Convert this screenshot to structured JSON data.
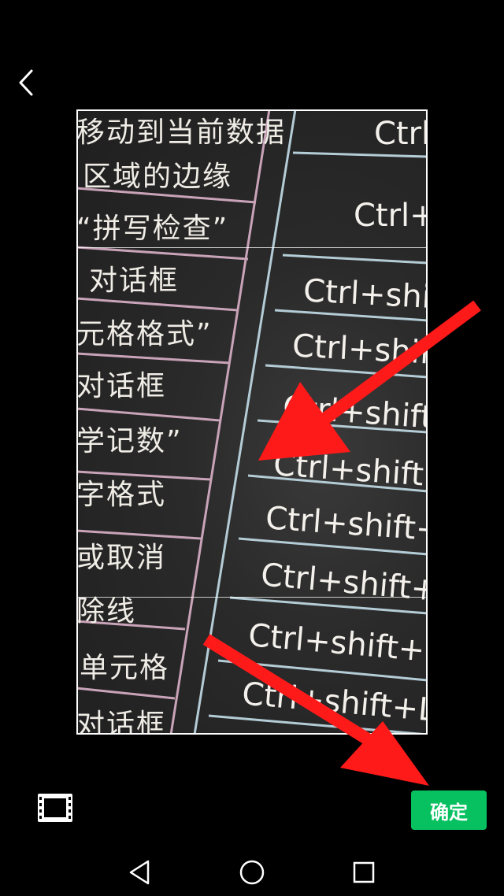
{
  "header": {
    "back_icon": "chevron-left-icon"
  },
  "photo": {
    "left_column_text": [
      "移动到当前数据",
      "区域的边缘",
      "“拼写检查”",
      "对话框",
      "元格格式”",
      "对话框",
      "学记数”",
      "字格式",
      "或取消",
      "除线",
      "单元格",
      "对话框"
    ],
    "right_column_text": [
      "Ctrl",
      "Ctrl+",
      "Ctrl+shif",
      "Ctrl+shif",
      "Ctrl+shift",
      "Ctrl+shift+",
      "Ctrl+shift+",
      "Ctrl+shift+",
      "Ctrl+shift+H",
      "Ctrl+shift+L"
    ]
  },
  "toolbar": {
    "ratio_icon": "crop-ratio-icon",
    "confirm_label": "确定",
    "confirm_color": "#07c160"
  },
  "navbar": {
    "back_icon": "nav-back-triangle-icon",
    "home_icon": "nav-home-circle-icon",
    "recents_icon": "nav-recents-square-icon"
  },
  "annotations": {
    "arrow_color": "#ff1a1a"
  }
}
